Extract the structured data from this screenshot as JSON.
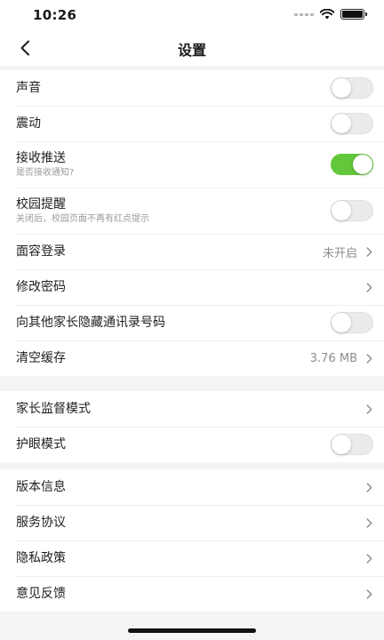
{
  "status_bar": {
    "time": "10:26"
  },
  "nav": {
    "title": "设置"
  },
  "group1": [
    {
      "label": "声音",
      "control": "toggle",
      "on": false
    },
    {
      "label": "震动",
      "control": "toggle",
      "on": false
    },
    {
      "label": "接收推送",
      "sub": "是否接收通知?",
      "control": "toggle",
      "on": true
    },
    {
      "label": "校园提醒",
      "sub": "关闭后，校园页面不再有红点提示",
      "control": "toggle",
      "on": false
    },
    {
      "label": "面容登录",
      "value": "未开启",
      "control": "chevron"
    },
    {
      "label": "修改密码",
      "control": "chevron"
    },
    {
      "label": "向其他家长隐藏通讯录号码",
      "control": "toggle",
      "on": false
    },
    {
      "label": "清空缓存",
      "value": "3.76 MB",
      "control": "chevron"
    }
  ],
  "group2": [
    {
      "label": "家长监督模式",
      "control": "chevron"
    },
    {
      "label": "护眼模式",
      "control": "toggle",
      "on": false
    }
  ],
  "group3": [
    {
      "label": "版本信息",
      "control": "chevron"
    },
    {
      "label": "服务协议",
      "control": "chevron"
    },
    {
      "label": "隐私政策",
      "control": "chevron"
    },
    {
      "label": "意见反馈",
      "control": "chevron"
    }
  ],
  "colors": {
    "toggle_on": "#62c73a",
    "toggle_off": "#ebebeb",
    "page_bg": "#f4f4f6"
  },
  "icons": {
    "back": "chevron-left-icon",
    "row_arrow": "chevron-right-icon"
  }
}
